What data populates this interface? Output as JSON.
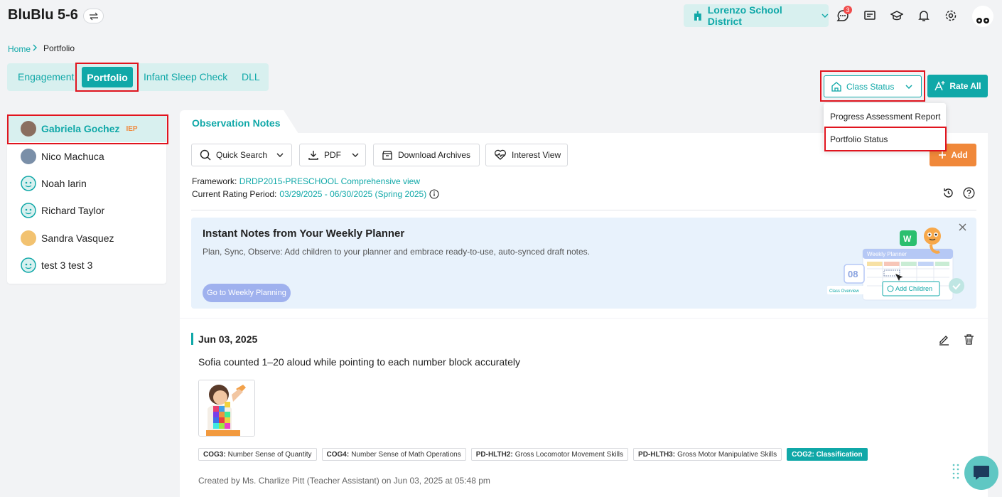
{
  "app": {
    "title": "BluBlu 5-6"
  },
  "header": {
    "district": "Lorenzo School District",
    "message_badge": "3"
  },
  "breadcrumb": {
    "home": "Home",
    "current": "Portfolio"
  },
  "tabs": [
    {
      "label": "Engagement"
    },
    {
      "label": "Portfolio"
    },
    {
      "label": "Infant Sleep Check"
    },
    {
      "label": "DLL"
    }
  ],
  "actions": {
    "class_status": "Class Status",
    "rate_all": "Rate All",
    "add": "Add"
  },
  "dropdown": {
    "items": [
      {
        "label": "Progress Assessment Report"
      },
      {
        "label": "Portfolio Status"
      }
    ]
  },
  "children": [
    {
      "name": "Gabriela Gochez",
      "tag": "IEP"
    },
    {
      "name": "Nico Machuca"
    },
    {
      "name": "Noah larin"
    },
    {
      "name": "Richard Taylor"
    },
    {
      "name": "Sandra Vasquez"
    },
    {
      "name": "test 3 test 3"
    }
  ],
  "panel": {
    "tab_title": "Observation Notes",
    "toolbar": {
      "quick_search": "Quick Search",
      "pdf": "PDF",
      "download_archives": "Download Archives",
      "interest_view": "Interest View"
    },
    "framework_label": "Framework:",
    "framework_value": "DRDP2015-PRESCHOOL Comprehensive view",
    "rating_label": "Current Rating Period:",
    "rating_value": "03/29/2025 - 06/30/2025 (Spring 2025)"
  },
  "banner": {
    "title": "Instant Notes from Your Weekly Planner",
    "text": "Plan, Sync, Observe: Add children to your planner and embrace ready-to-use, auto-synced draft notes.",
    "button": "Go to Weekly Planning",
    "illus_planner": "Weekly Planner",
    "illus_add_children": "Add Children",
    "illus_class_overview": "Class Overview",
    "illus_date": "08"
  },
  "note": {
    "date": "Jun 03, 2025",
    "text": "Sofia counted 1–20 aloud while pointing to each number block accurately",
    "tags": [
      {
        "code": "COG3:",
        "label": "Number Sense of Quantity",
        "highlight": false
      },
      {
        "code": "COG4:",
        "label": "Number Sense of Math Operations",
        "highlight": false
      },
      {
        "code": "PD-HLTH2:",
        "label": "Gross Locomotor Movement Skills",
        "highlight": false
      },
      {
        "code": "PD-HLTH3:",
        "label": "Gross Motor Manipulative Skills",
        "highlight": false
      },
      {
        "code": "COG2:",
        "label": "Classification",
        "highlight": true
      }
    ],
    "created": "Created by Ms. Charlize Pitt (Teacher Assistant) on Jun 03, 2025 at 05:48 pm"
  },
  "colors": {
    "accent": "#10a8a8",
    "orange": "#f0883a",
    "highlight_border": "#e0141e"
  }
}
